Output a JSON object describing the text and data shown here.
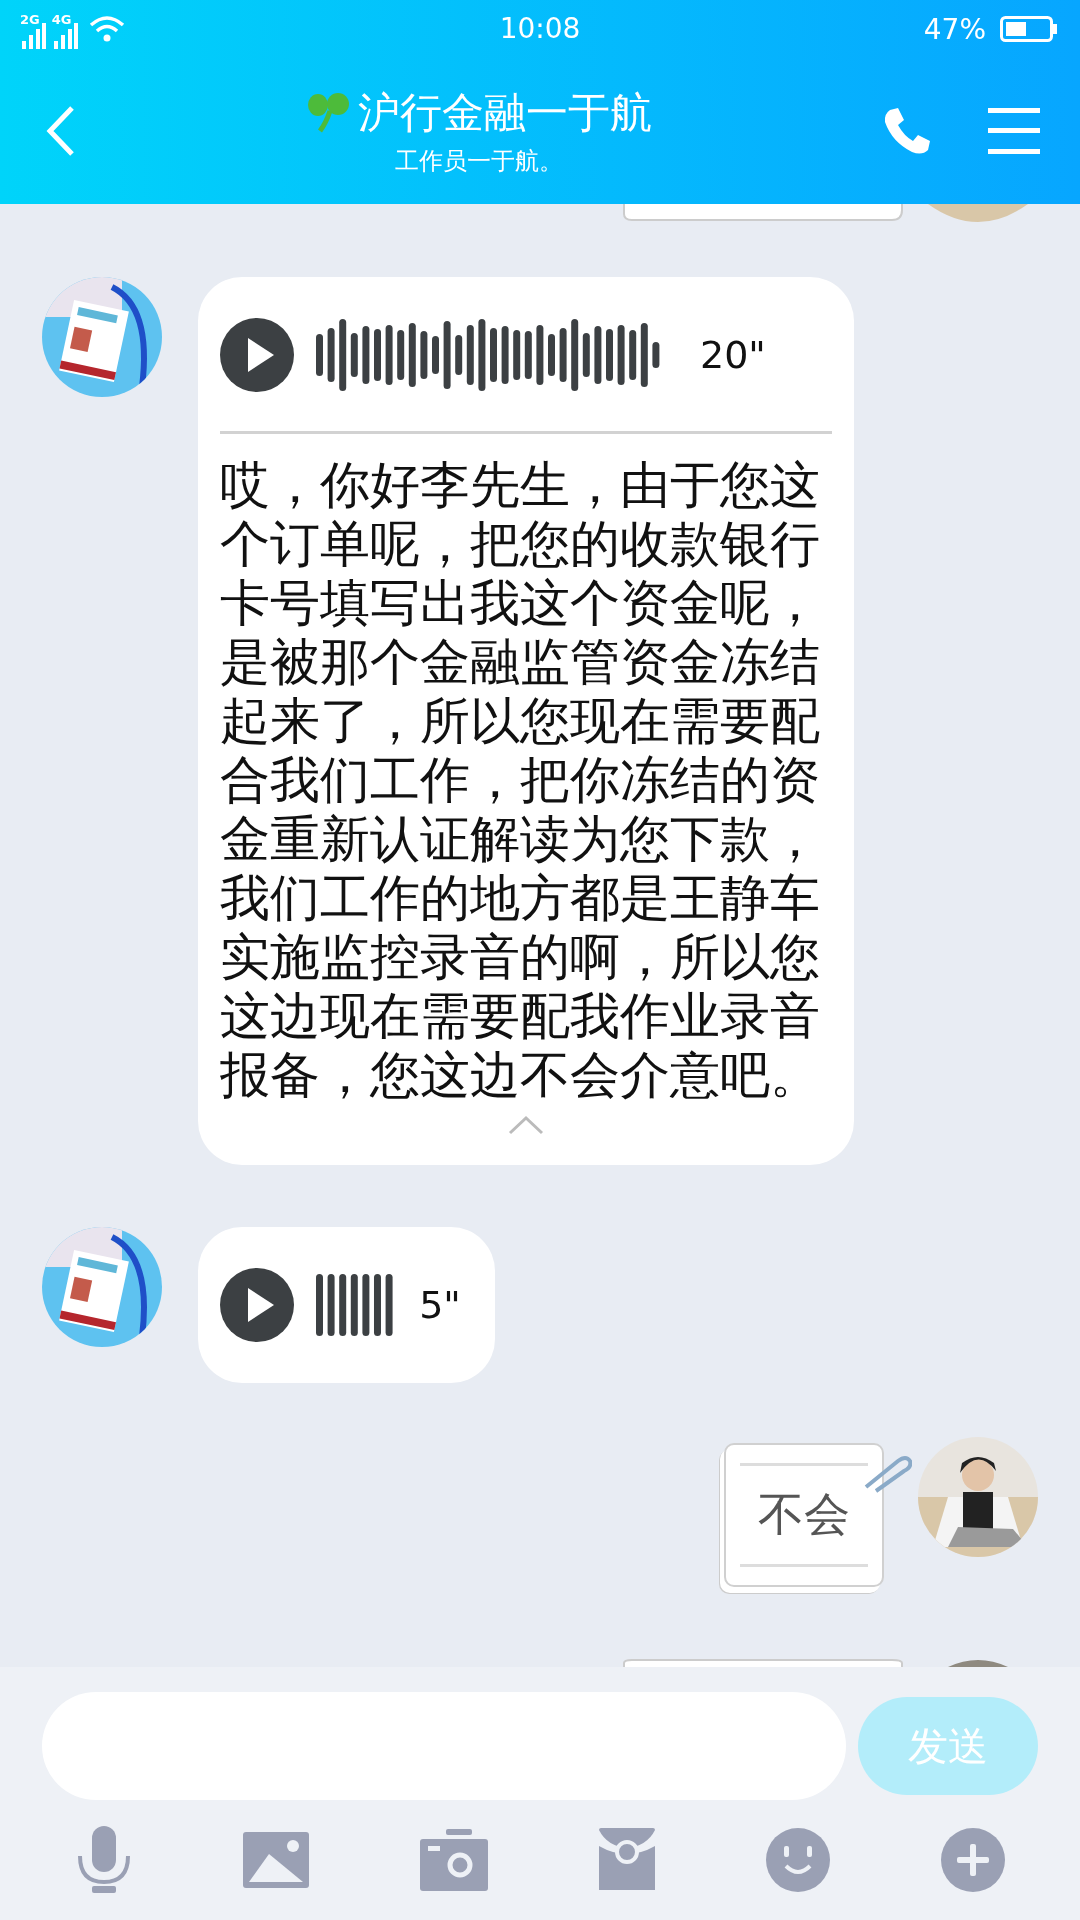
{
  "status_bar": {
    "network_1": "2G",
    "network_2": "4G",
    "time": "10:08",
    "battery": "47%"
  },
  "header": {
    "title": "沪行金融一于航",
    "subtitle": "工作员一于航。"
  },
  "messages": [
    {
      "kind": "voice",
      "outgoing": false,
      "duration": "20\"",
      "expanded": true,
      "transcript": "哎，你好李先生，由于您这个订单呢，把您的收款银行卡号填写出我这个资金呢，是被那个金融监管资金冻结起来了，所以您现在需要配合我们工作，把你冻结的资金重新认证解读为您下款，我们工作的地方都是王静车实施监控录音的啊，所以您这边现在需要配我作业录音报备，您这边不会介意吧。"
    },
    {
      "kind": "voice",
      "outgoing": false,
      "duration": "5\""
    },
    {
      "kind": "text",
      "outgoing": true,
      "text": "不会"
    }
  ],
  "composer": {
    "send": {
      "label": "发送",
      "disabled": true
    }
  }
}
